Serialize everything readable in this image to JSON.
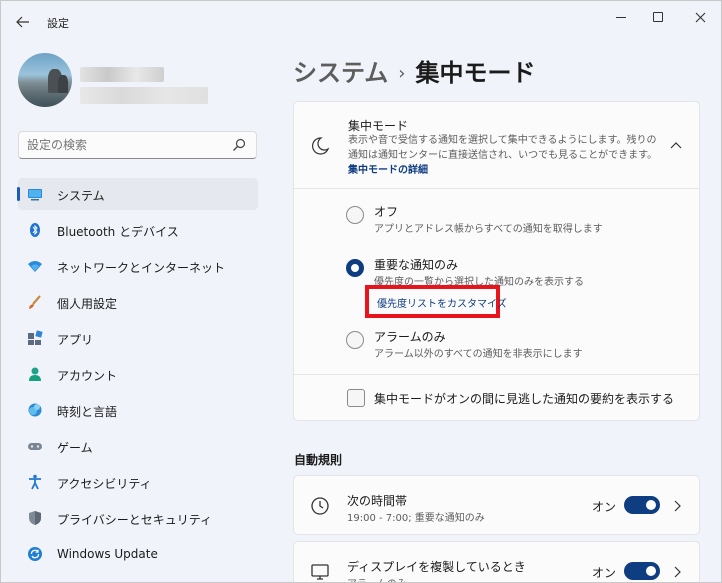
{
  "window": {
    "title": "設定"
  },
  "search": {
    "placeholder": "設定の検索"
  },
  "sidebar": {
    "items": [
      {
        "label": "システム",
        "icon": "system-icon",
        "active": true
      },
      {
        "label": "Bluetooth とデバイス",
        "icon": "bluetooth-icon"
      },
      {
        "label": "ネットワークとインターネット",
        "icon": "network-icon"
      },
      {
        "label": "個人用設定",
        "icon": "personalization-icon"
      },
      {
        "label": "アプリ",
        "icon": "apps-icon"
      },
      {
        "label": "アカウント",
        "icon": "accounts-icon"
      },
      {
        "label": "時刻と言語",
        "icon": "time-language-icon"
      },
      {
        "label": "ゲーム",
        "icon": "gaming-icon"
      },
      {
        "label": "アクセシビリティ",
        "icon": "accessibility-icon"
      },
      {
        "label": "プライバシーとセキュリティ",
        "icon": "privacy-icon"
      },
      {
        "label": "Windows Update",
        "icon": "windows-update-icon"
      }
    ]
  },
  "breadcrumb": {
    "parent": "システム",
    "separator": "›",
    "current": "集中モード"
  },
  "focus": {
    "title": "集中モード",
    "description": "表示や音で受信する通知を選択して集中できるようにします。残りの通知は通知センターに直接送信され、いつでも見ることができます。",
    "details_link": "集中モードの詳細",
    "options": [
      {
        "label": "オフ",
        "sub": "アプリとアドレス帳からすべての通知を取得します",
        "checked": false
      },
      {
        "label": "重要な通知のみ",
        "sub": "優先度の一覧から選択した通知のみを表示する",
        "checked": true
      },
      {
        "label": "アラームのみ",
        "sub": "アラーム以外のすべての通知を非表示にします",
        "checked": false
      }
    ],
    "customize_link": "優先度リストをカスタマイズ",
    "summary_checkbox": "集中モードがオンの間に見逃した通知の要約を表示する"
  },
  "rules": {
    "section_title": "自動規則",
    "items": [
      {
        "title": "次の時間帯",
        "sub": "19:00 - 7:00; 重要な通知のみ",
        "state": "オン",
        "icon": "clock-icon"
      },
      {
        "title": "ディスプレイを複製しているとき",
        "sub": "アラームのみ",
        "state": "オン",
        "icon": "monitor-icon"
      }
    ]
  },
  "colors": {
    "accent": "#0f3d82",
    "highlight_box": "#e8141b"
  }
}
